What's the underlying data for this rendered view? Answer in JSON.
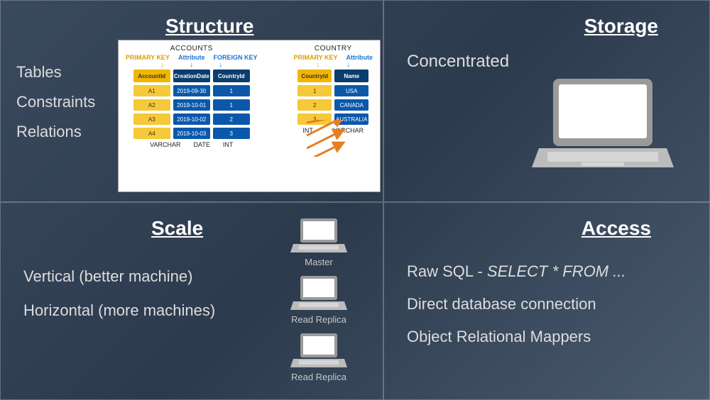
{
  "quadrants": {
    "structure": {
      "title": "Structure",
      "bullets": [
        "Tables",
        "Constraints",
        "Relations"
      ],
      "diagram": {
        "accounts": {
          "title": "ACCOUNTS",
          "col_labels": [
            "PRIMARY KEY",
            "Attribute",
            "FOREIGN KEY"
          ],
          "headers": [
            "AccountId",
            "CreationDate",
            "CountryId"
          ],
          "rows": [
            [
              "A1",
              "2019-09-30",
              "1"
            ],
            [
              "A2",
              "2019-10-01",
              "1"
            ],
            [
              "A3",
              "2019-10-02",
              "2"
            ],
            [
              "A4",
              "2019-10-03",
              "3"
            ]
          ],
          "types": [
            "VARCHAR",
            "DATE",
            "INT"
          ]
        },
        "country": {
          "title": "COUNTRY",
          "col_labels": [
            "PRIMARY KEY",
            "Attribute"
          ],
          "headers": [
            "CountryId",
            "Name"
          ],
          "rows": [
            [
              "1",
              "USA"
            ],
            [
              "2",
              "CANADA"
            ],
            [
              "3",
              "AUSTRALIA"
            ]
          ],
          "types": [
            "INT",
            "VARCHAR"
          ]
        }
      }
    },
    "storage": {
      "title": "Storage",
      "text": "Concentrated"
    },
    "scale": {
      "title": "Scale",
      "lines": [
        "Vertical (better machine)",
        "Horizontal (more machines)"
      ],
      "laptops": [
        "Master",
        "Read Replica",
        "Read Replica"
      ]
    },
    "access": {
      "title": "Access",
      "lines": {
        "l1a": "Raw SQL - ",
        "l1b": "SELECT * FROM ...",
        "l2": "Direct database connection",
        "l3": "Object Relational Mappers"
      }
    }
  }
}
